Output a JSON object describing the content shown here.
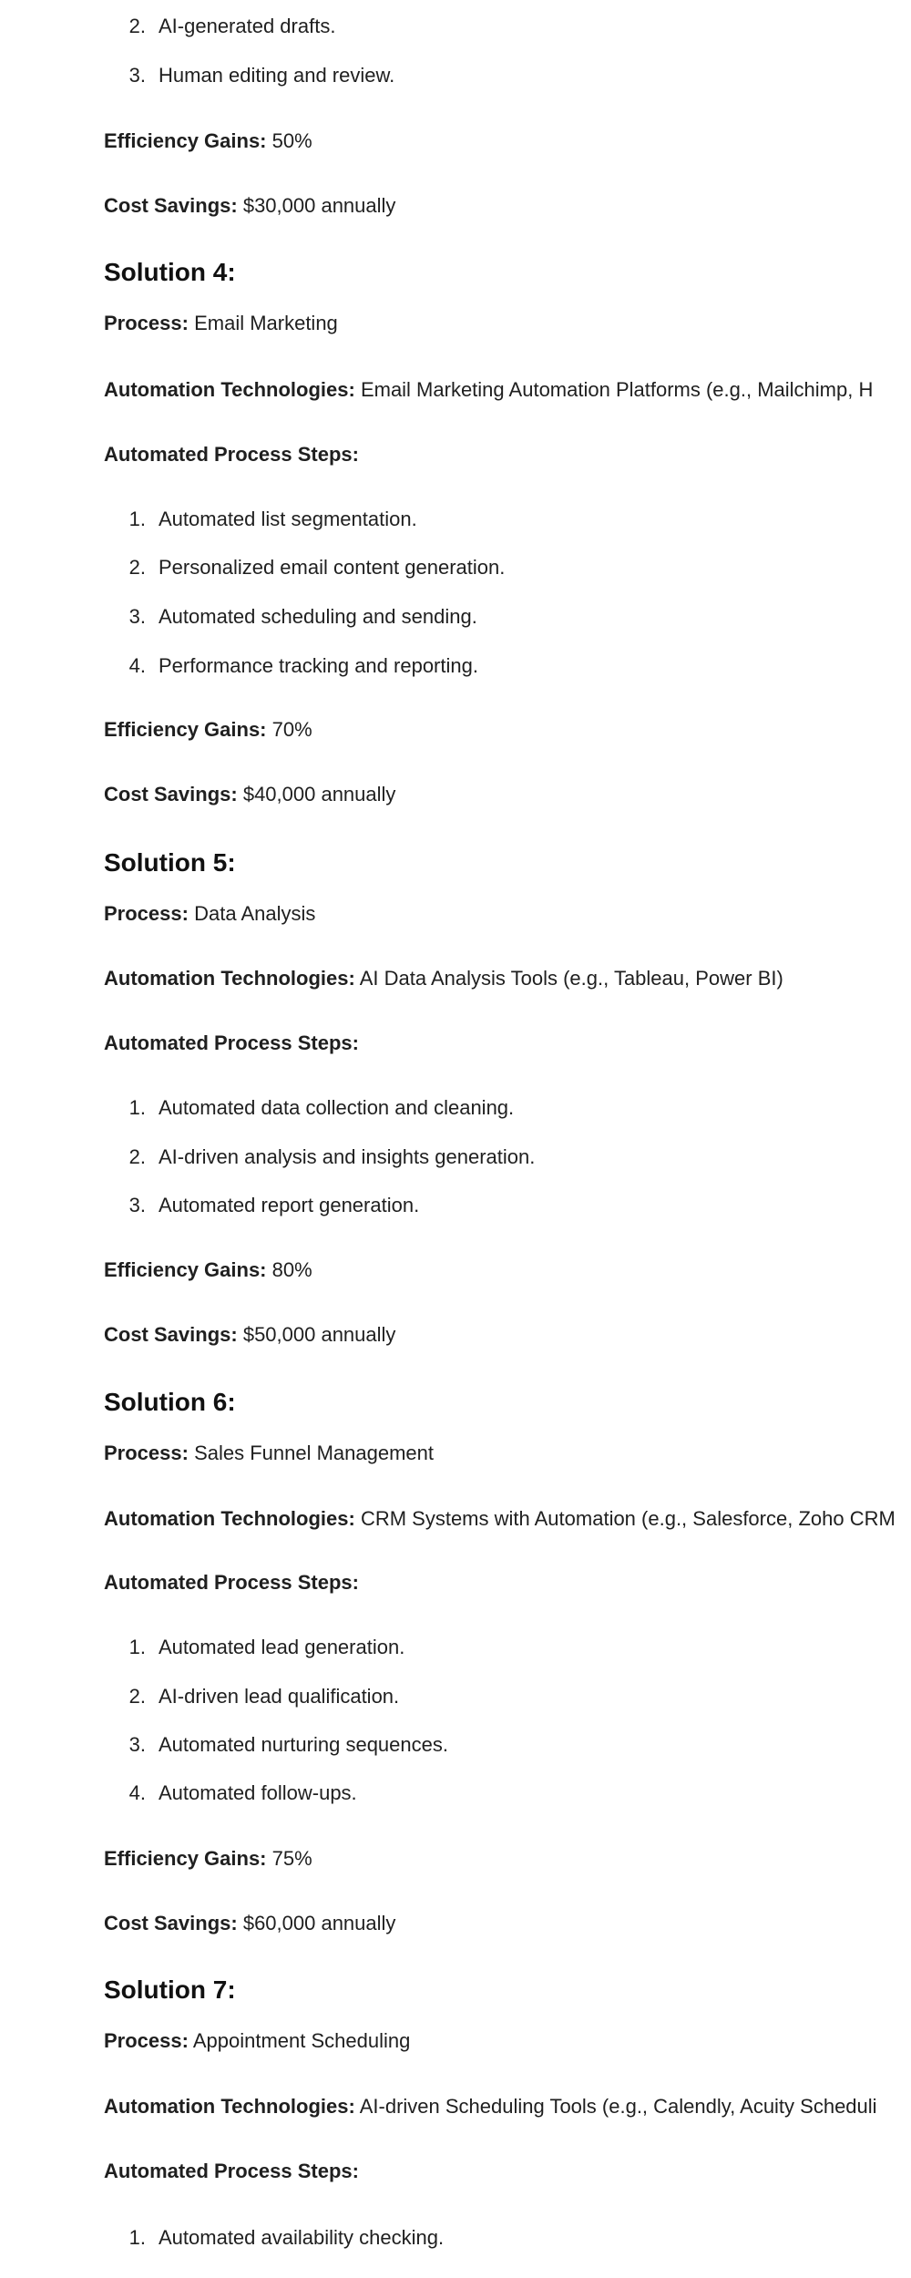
{
  "intro_steps": [
    {
      "num": "2.",
      "text": "AI-generated drafts."
    },
    {
      "num": "3.",
      "text": "Human editing and review."
    }
  ],
  "intro_efficiency": {
    "label": "Efficiency Gains:",
    "value": "50%"
  },
  "intro_savings": {
    "label": "Cost Savings:",
    "value": "$30,000 annually"
  },
  "labels": {
    "process": "Process:",
    "technologies": "Automation Technologies:",
    "steps": "Automated Process Steps:",
    "efficiency": "Efficiency Gains:",
    "savings": "Cost Savings:"
  },
  "solutions": [
    {
      "title": "Solution 4:",
      "process": "Email Marketing",
      "technologies": "Email Marketing Automation Platforms (e.g., Mailchimp, H",
      "steps": [
        {
          "num": "1.",
          "text": "Automated list segmentation."
        },
        {
          "num": "2.",
          "text": "Personalized email content generation."
        },
        {
          "num": "3.",
          "text": "Automated scheduling and sending."
        },
        {
          "num": "4.",
          "text": "Performance tracking and reporting."
        }
      ],
      "efficiency": "70%",
      "savings": "$40,000 annually"
    },
    {
      "title": "Solution 5:",
      "process": "Data Analysis",
      "technologies": "AI Data Analysis Tools (e.g., Tableau, Power BI)",
      "steps": [
        {
          "num": "1.",
          "text": "Automated data collection and cleaning."
        },
        {
          "num": "2.",
          "text": "AI-driven analysis and insights generation."
        },
        {
          "num": "3.",
          "text": "Automated report generation."
        }
      ],
      "efficiency": "80%",
      "savings": "$50,000 annually"
    },
    {
      "title": "Solution 6:",
      "process": "Sales Funnel Management",
      "technologies": "CRM Systems with Automation (e.g., Salesforce, Zoho CRM",
      "steps": [
        {
          "num": "1.",
          "text": "Automated lead generation."
        },
        {
          "num": "2.",
          "text": "AI-driven lead qualification."
        },
        {
          "num": "3.",
          "text": "Automated nurturing sequences."
        },
        {
          "num": "4.",
          "text": "Automated follow-ups."
        }
      ],
      "efficiency": "75%",
      "savings": "$60,000 annually"
    },
    {
      "title": "Solution 7:",
      "process": "Appointment Scheduling",
      "technologies": "AI-driven Scheduling Tools (e.g., Calendly, Acuity Scheduli",
      "steps": [
        {
          "num": "1.",
          "text": "Automated availability checking."
        }
      ]
    }
  ]
}
